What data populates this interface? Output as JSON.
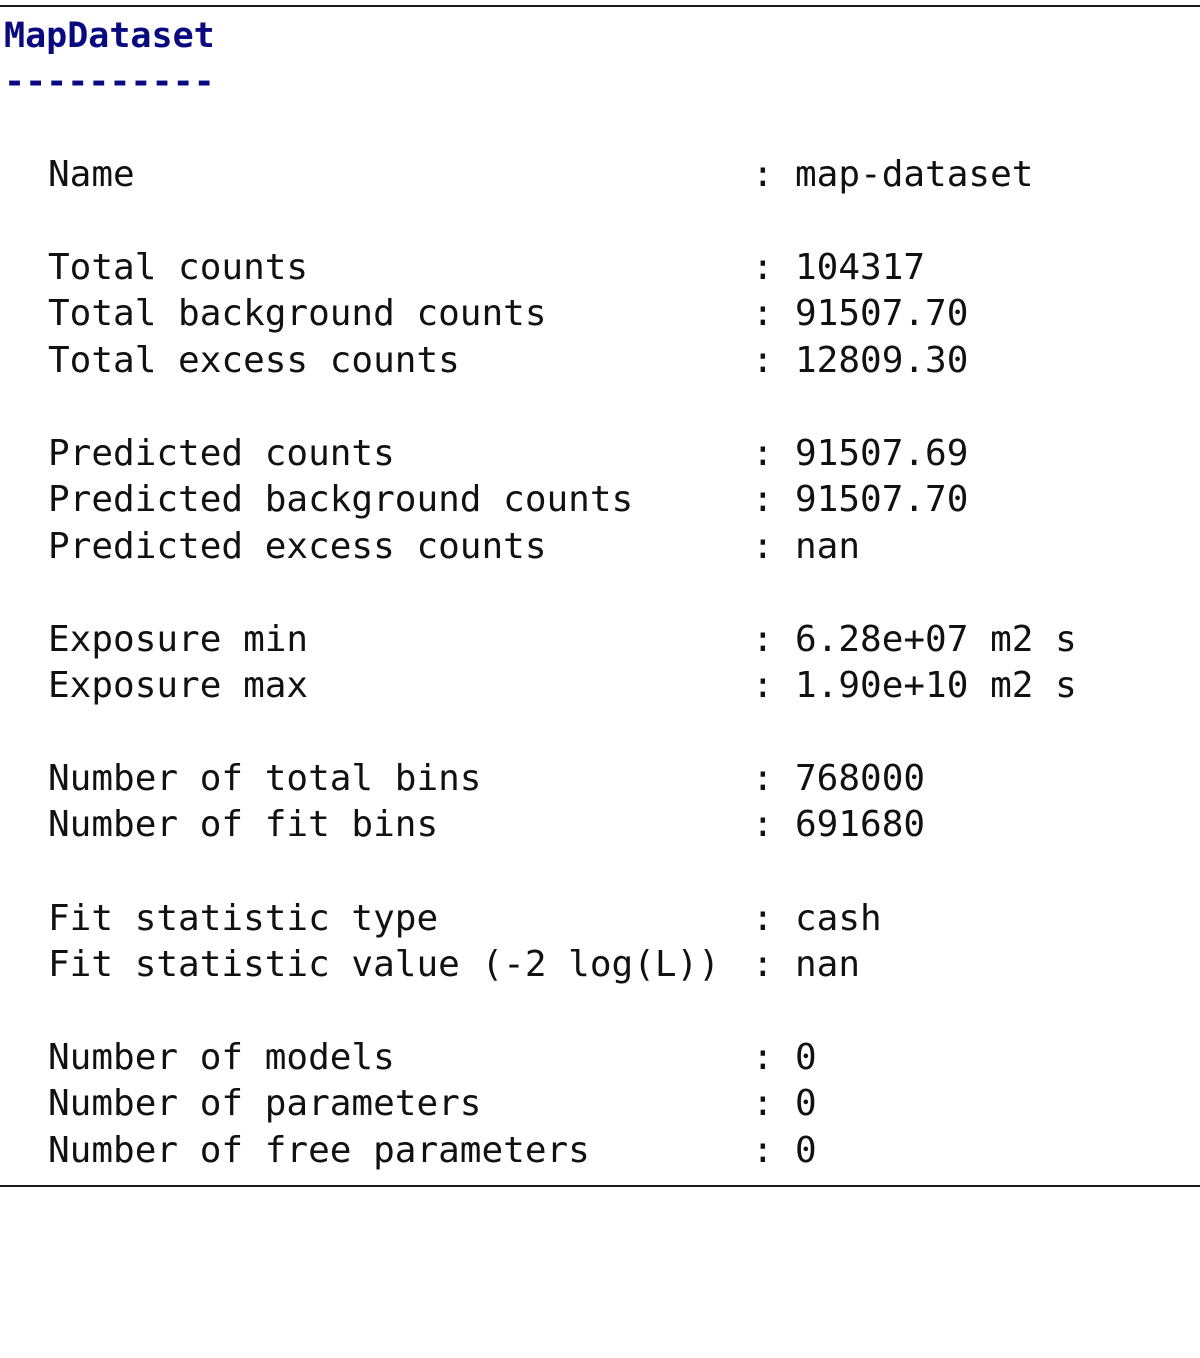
{
  "header": {
    "title": "MapDataset",
    "underline": "----------"
  },
  "separator": ":",
  "rows": [
    {
      "label": "Name",
      "value": "map-dataset"
    },
    {
      "label": "Total counts",
      "value": "104317"
    },
    {
      "label": "Total background counts",
      "value": "91507.70"
    },
    {
      "label": "Total excess counts",
      "value": "12809.30"
    },
    {
      "label": "Predicted counts",
      "value": "91507.69"
    },
    {
      "label": "Predicted background counts",
      "value": "91507.70"
    },
    {
      "label": "Predicted excess counts",
      "value": "nan"
    },
    {
      "label": "Exposure min",
      "value": "6.28e+07 m2 s"
    },
    {
      "label": "Exposure max",
      "value": "1.90e+10 m2 s"
    },
    {
      "label": "Number of total bins",
      "value": "768000"
    },
    {
      "label": "Number of fit bins",
      "value": "691680"
    },
    {
      "label": "Fit statistic type",
      "value": "cash"
    },
    {
      "label": "Fit statistic value (-2 log(L))",
      "value": "nan"
    },
    {
      "label": "Number of models",
      "value": "0"
    },
    {
      "label": "Number of parameters",
      "value": "0"
    },
    {
      "label": "Number of free parameters",
      "value": "0"
    }
  ]
}
